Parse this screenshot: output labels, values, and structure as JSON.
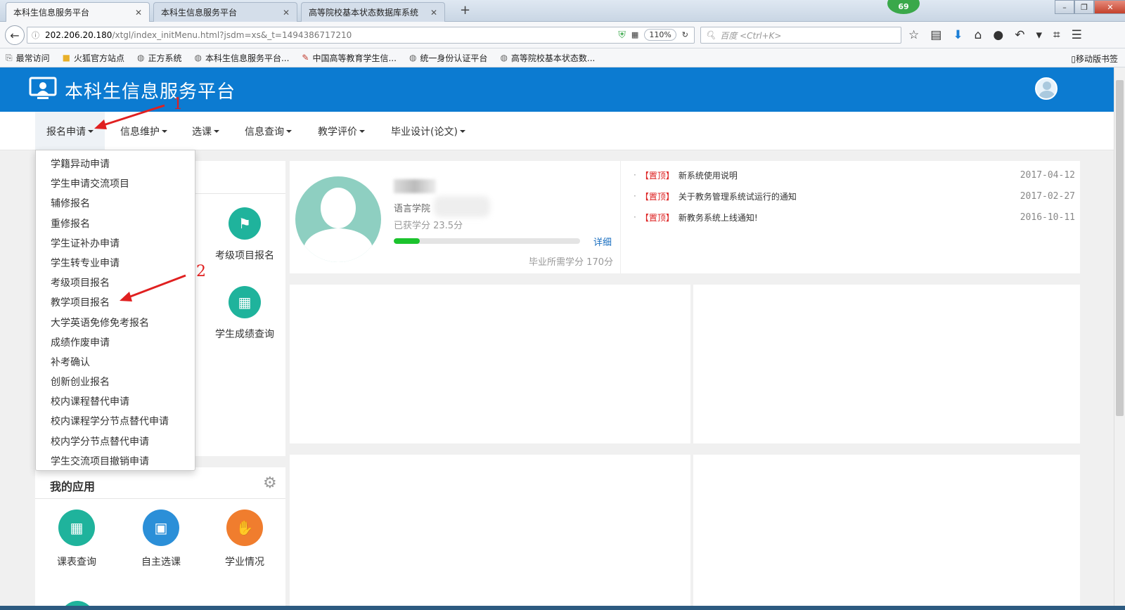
{
  "browser": {
    "tabs": [
      {
        "label": "本科生信息服务平台",
        "active": true
      },
      {
        "label": "本科生信息服务平台",
        "active": false
      },
      {
        "label": "高等院校基本状态数据库系统",
        "active": false
      }
    ],
    "new_tab": "+",
    "badge": "69",
    "url_host": "202.206.20.180",
    "url_path": "/xtgl/index_initMenu.html?jsdm=xs&_t=1494386717210",
    "zoom": "110%",
    "search_placeholder": "百度 <Ctrl+K>",
    "bookmarks": [
      {
        "label": "最常访问",
        "icon": "bookmark-icon"
      },
      {
        "label": "火狐官方站点",
        "icon": "folder-icon"
      },
      {
        "label": "正方系统",
        "icon": "globe-icon"
      },
      {
        "label": "本科生信息服务平台...",
        "icon": "globe-icon"
      },
      {
        "label": "中国高等教育学生信...",
        "icon": "feather-icon"
      },
      {
        "label": "统一身份认证平台",
        "icon": "globe-icon"
      },
      {
        "label": "高等院校基本状态数...",
        "icon": "globe-icon"
      }
    ],
    "mobile_bookmarks": "移动版书签"
  },
  "header": {
    "title": "本科生信息服务平台"
  },
  "menu": [
    {
      "label": "报名申请",
      "open": true
    },
    {
      "label": "信息维护"
    },
    {
      "label": "选课"
    },
    {
      "label": "信息查询"
    },
    {
      "label": "教学评价"
    },
    {
      "label": "毕业设计(论文)"
    }
  ],
  "dropdown": [
    "学籍异动申请",
    "学生申请交流项目",
    "辅修报名",
    "重修报名",
    "学生证补办申请",
    "学生转专业申请",
    "考级项目报名",
    "教学项目报名",
    "大学英语免修免考报名",
    "成绩作废申请",
    "补考确认",
    "创新创业报名",
    "校内课程替代申请",
    "校内课程学分节点替代申请",
    "校内学分节点替代申请",
    "学生交流项目撤销申请"
  ],
  "quick_apps": [
    {
      "label": "考级项目报名",
      "icon": "exam-register-icon"
    },
    {
      "label": "学生成绩查询",
      "icon": "grade-query-icon"
    }
  ],
  "profile": {
    "college": "语言学院",
    "earned_credits": "已获学分 23.5分",
    "progress": 0.14,
    "detail": "详细",
    "required_credits": "毕业所需学分 170分"
  },
  "notices": [
    {
      "tag": "【置顶】",
      "text": "新系统使用说明",
      "date": "2017-04-12"
    },
    {
      "tag": "【置顶】",
      "text": "关于教务管理系统试运行的通知",
      "date": "2017-02-27"
    },
    {
      "tag": "【置顶】",
      "text": "新教务系统上线通知!",
      "date": "2016-10-11"
    }
  ],
  "my_apps": {
    "title": "我的应用",
    "items": [
      {
        "label": "课表查询",
        "icon": "timetable-icon"
      },
      {
        "label": "自主选课",
        "icon": "course-select-icon"
      },
      {
        "label": "学业情况",
        "icon": "academic-status-icon"
      }
    ]
  },
  "annotations": [
    "1",
    "2"
  ],
  "colors": {
    "header_blue": "#0c7bd1",
    "teal": "#1fb39c",
    "progress_green": "#1bc32d",
    "notice_red": "#dd2222",
    "annotation_red": "#e02020"
  }
}
